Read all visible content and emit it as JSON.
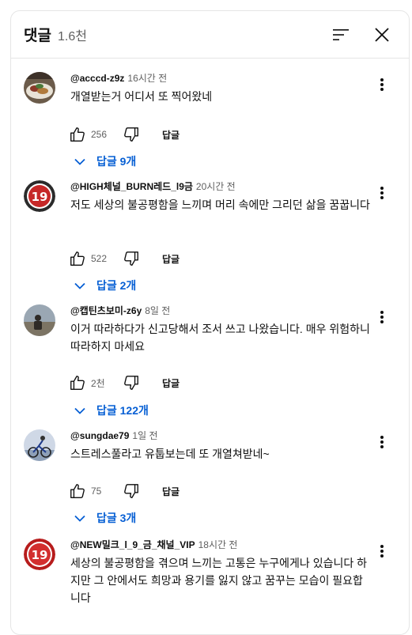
{
  "header": {
    "title": "댓글",
    "count": "1.6천"
  },
  "comments": [
    {
      "author": "@acccd-z9z",
      "time": "16시간 전",
      "text": "개열받는거 어디서 또 찍어왔네",
      "likes": "256",
      "reply_label": "답글",
      "replies_label": "답글 9개",
      "avatar": "food-photo"
    },
    {
      "author": "@HIGH체널_BURN레드_l9금",
      "time": "20시간 전",
      "text": "저도 세상의 불공평함을 느끼며 머리 속에만 그리던 삶을 꿈꿉니다",
      "likes": "522",
      "reply_label": "답글",
      "replies_label": "답글 2개",
      "avatar": "19-badge"
    },
    {
      "author": "@캡틴츠보미-z6y",
      "time": "8일 전",
      "text": "이거 따라하다가 신고당해서 조서 쓰고 나왔습니다. 매우 위험하니 따라하지 마세요",
      "likes": "2천",
      "reply_label": "답글",
      "replies_label": "답글 122개",
      "avatar": "person-photo"
    },
    {
      "author": "@sungdae79",
      "time": "1일 전",
      "text": "스트레스풀라고 유툽보는데 또 개열쳐받네~",
      "likes": "75",
      "reply_label": "답글",
      "replies_label": "답글 3개",
      "avatar": "cyclist-photo"
    },
    {
      "author": "@NEW밀크_l_9_금_채널_VIP",
      "time": "18시간 전",
      "text": "세상의 불공평함을 겪으며 느끼는 고통은 누구에게나 있습니다 하지만 그 안에서도 희망과 용기를 잃지 않고 꿈꾸는 모습이 필요합니다",
      "likes": "",
      "reply_label": "",
      "replies_label": "",
      "avatar": "19-badge"
    }
  ],
  "colors": {
    "link_blue": "#065fd4",
    "secondary_text": "#606060",
    "badge_red": "#d32f2f"
  }
}
